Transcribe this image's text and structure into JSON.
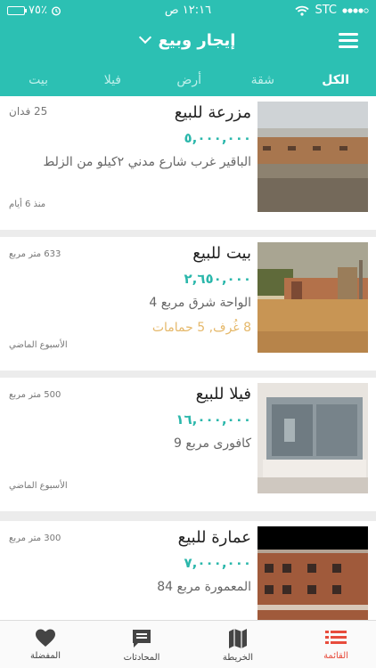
{
  "status_bar": {
    "carrier": "STC",
    "time": "١٢:١٦ ص",
    "battery": "٧٥٪",
    "battery_level": 0.75
  },
  "header": {
    "title": "إيجار وبيع"
  },
  "tabs": [
    {
      "label": "الكل",
      "active": true
    },
    {
      "label": "شقة",
      "active": false
    },
    {
      "label": "أرض",
      "active": false
    },
    {
      "label": "فيلا",
      "active": false
    },
    {
      "label": "بيت",
      "active": false
    }
  ],
  "listings": [
    {
      "title": "مزرعة للبيع",
      "price": "٥,٠٠٠,٠٠٠",
      "location": "الباقير غرب شارع مدني ٢كيلو من الزلط",
      "details": "",
      "area": "25 فدان",
      "time": "منذ 6 أيام"
    },
    {
      "title": "بيت للبيع",
      "price": "٢,٦٥٠,٠٠٠",
      "location": "الواحة شرق مربع 4",
      "details": "8 غُرف, 5 حمامات",
      "area": "633 متر مربع",
      "time": "الأسبوع الماضي"
    },
    {
      "title": "فيلا للبيع",
      "price": "١٦,٠٠٠,٠٠٠",
      "location": "كافورى مربع 9",
      "details": "",
      "area": "500 متر مربع",
      "time": "الأسبوع الماضي"
    },
    {
      "title": "عمارة للبيع",
      "price": "٧,٠٠٠,٠٠٠",
      "location": "المعمورة مربع 84",
      "details": "",
      "area": "300 متر مربع",
      "time": ""
    }
  ],
  "bottom_tabs": [
    {
      "label": "القائمة",
      "icon": "list-icon",
      "active": true
    },
    {
      "label": "الخريطة",
      "icon": "map-icon",
      "active": false
    },
    {
      "label": "المحادثات",
      "icon": "chat-icon",
      "active": false
    },
    {
      "label": "المفضلة",
      "icon": "heart-icon",
      "active": false
    }
  ],
  "colors": {
    "accent": "#2cc0b3",
    "price": "#2bb7ab",
    "details": "#e5b86a",
    "active_tab": "#e74c3c"
  }
}
